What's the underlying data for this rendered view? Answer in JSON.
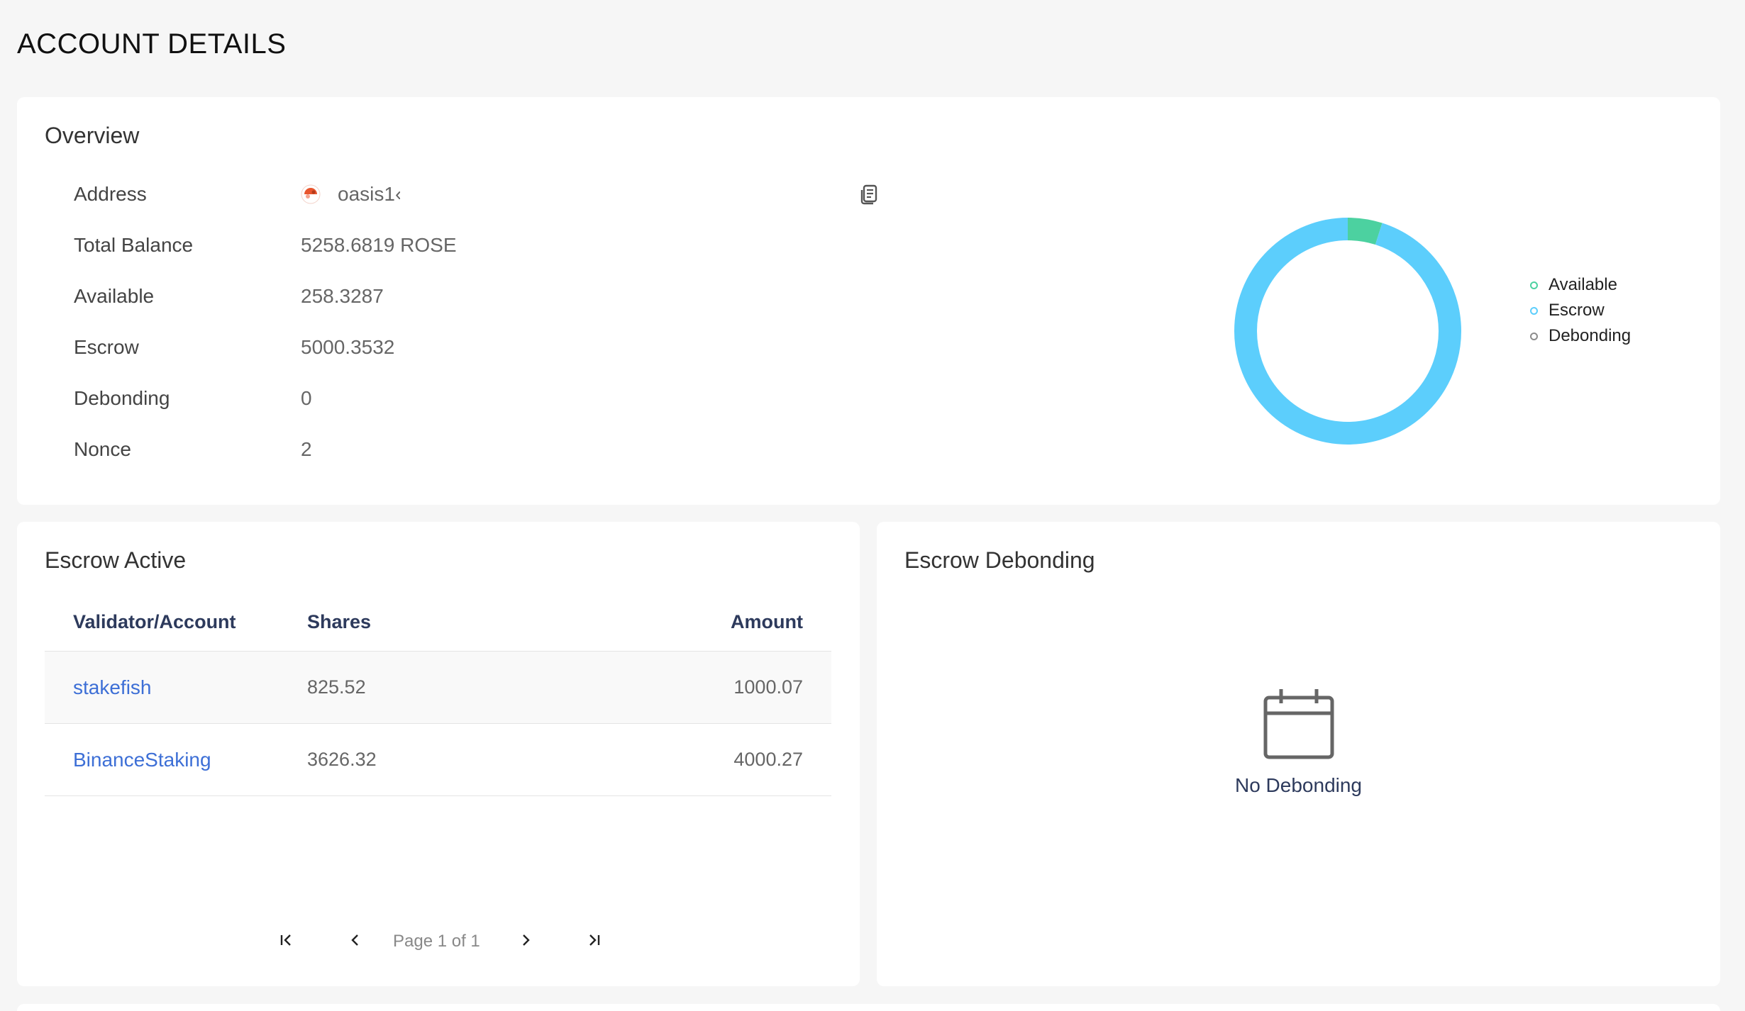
{
  "page": {
    "title": "ACCOUNT DETAILS"
  },
  "overview": {
    "title": "Overview",
    "rows": [
      {
        "label": "Address",
        "value": "oasis1‹"
      },
      {
        "label": "Total Balance",
        "value": "5258.6819 ROSE"
      },
      {
        "label": "Available",
        "value": "258.3287"
      },
      {
        "label": "Escrow",
        "value": "5000.3532"
      },
      {
        "label": "Debonding",
        "value": "0"
      },
      {
        "label": "Nonce",
        "value": "2"
      }
    ],
    "copy_icon": "copy-icon",
    "legend": [
      {
        "label": "Available",
        "color": "#4cd1a0"
      },
      {
        "label": "Escrow",
        "color": "#5ccefc"
      },
      {
        "label": "Debonding",
        "color": "#8c8c8c"
      }
    ]
  },
  "chart_data": {
    "type": "pie",
    "categories": [
      "Available",
      "Escrow",
      "Debonding"
    ],
    "values": [
      258.3287,
      5000.3532,
      0
    ],
    "colors": [
      "#4cd1a0",
      "#5ccefc",
      "#8c8c8c"
    ],
    "legend": "right"
  },
  "escrow_active": {
    "title": "Escrow Active",
    "columns": [
      "Validator/Account",
      "Shares",
      "Amount"
    ],
    "rows": [
      {
        "account": "stakefish",
        "shares": "825.52",
        "amount": "1000.07"
      },
      {
        "account": "BinanceStaking",
        "shares": "3626.32",
        "amount": "4000.27"
      }
    ],
    "pager": {
      "text": "Page 1 of 1"
    }
  },
  "escrow_debonding": {
    "title": "Escrow Debonding",
    "empty_text": "No Debonding",
    "empty_icon": "calendar-icon"
  }
}
